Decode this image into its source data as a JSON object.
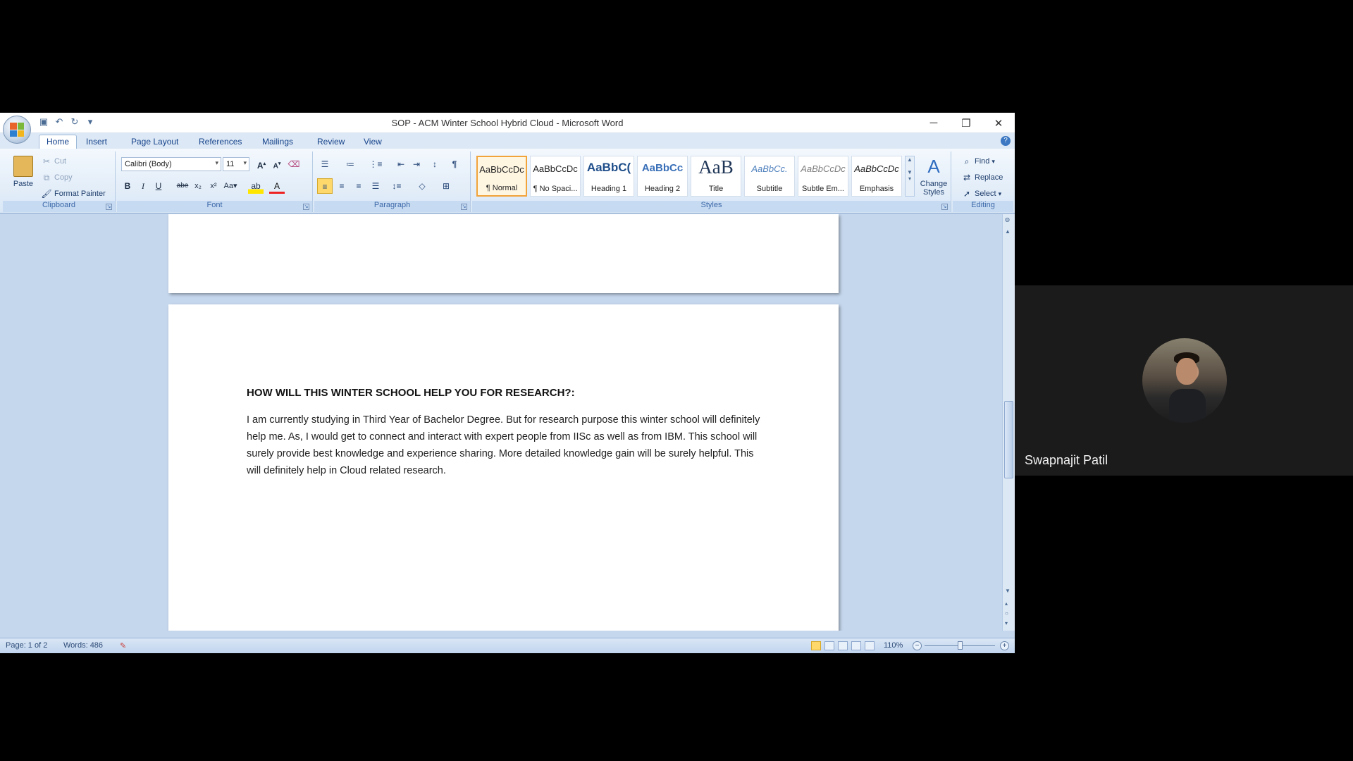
{
  "window": {
    "title": "SOP - ACM Winter School Hybrid Cloud - Microsoft Word",
    "controls": {
      "minimize": "─",
      "restore": "❐",
      "close": "✕"
    }
  },
  "tabs": [
    "Home",
    "Insert",
    "Page Layout",
    "References",
    "Mailings",
    "Review",
    "View"
  ],
  "ribbon": {
    "clipboard": {
      "label": "Clipboard",
      "paste": "Paste",
      "cut": "Cut",
      "copy": "Copy",
      "format_painter": "Format Painter"
    },
    "font": {
      "label": "Font",
      "font_name": "Calibri (Body)",
      "font_size": "11"
    },
    "paragraph": {
      "label": "Paragraph"
    },
    "styles": {
      "label": "Styles",
      "items": [
        {
          "preview": "AaBbCcDc",
          "name": "¶ Normal"
        },
        {
          "preview": "AaBbCcDc",
          "name": "¶ No Spaci..."
        },
        {
          "preview": "AaBbC(",
          "name": "Heading 1"
        },
        {
          "preview": "AaBbCc",
          "name": "Heading 2"
        },
        {
          "preview": "AaB",
          "name": "Title"
        },
        {
          "preview": "AaBbCc.",
          "name": "Subtitle"
        },
        {
          "preview": "AaBbCcDc",
          "name": "Subtle Em..."
        },
        {
          "preview": "AaBbCcDc",
          "name": "Emphasis"
        }
      ],
      "change_styles": "Change Styles"
    },
    "editing": {
      "label": "Editing",
      "find": "Find",
      "replace": "Replace",
      "select": "Select"
    }
  },
  "document": {
    "heading": "HOW WILL THIS WINTER SCHOOL HELP YOU FOR RESEARCH?:",
    "body": "I am currently studying in Third Year of Bachelor Degree. But for research purpose this winter school will definitely help me. As, I would get to connect and interact with expert people from IISc as well as from IBM. This school will surely provide best knowledge and experience sharing. More detailed knowledge gain will be surely helpful. This will definitely help in Cloud related research."
  },
  "status": {
    "page": "Page: 1 of 2",
    "words": "Words: 486",
    "zoom": "110%"
  },
  "participant": {
    "name": "Swapnajit Patil"
  },
  "colors": {
    "ribbon_blue": "#c5d7ed",
    "selected_style": "#f2a33a",
    "background": "#000000"
  }
}
